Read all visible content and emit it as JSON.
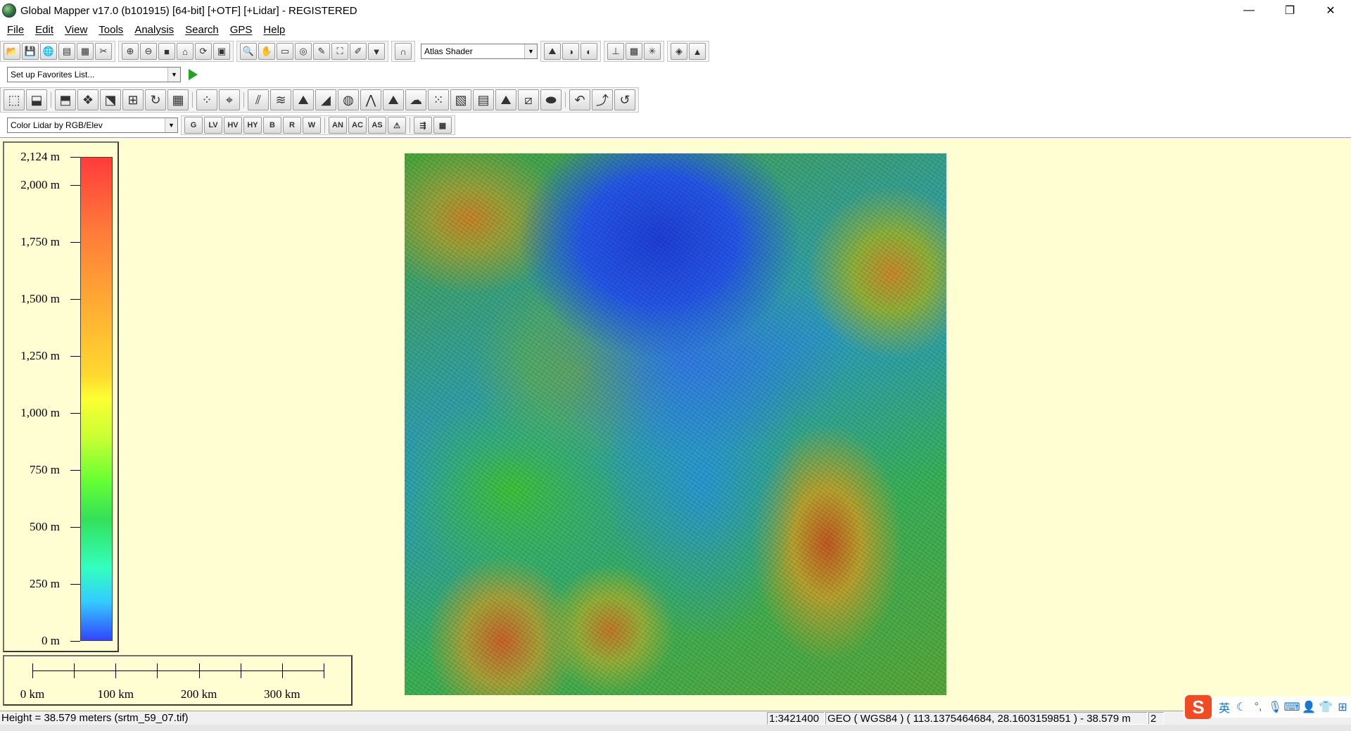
{
  "window": {
    "title": "Global Mapper v17.0 (b101915) [64-bit] [+OTF] [+Lidar] - REGISTERED",
    "minimize_glyph": "—",
    "restore_glyph": "❐",
    "close_glyph": "✕"
  },
  "menu": [
    "File",
    "Edit",
    "View",
    "Tools",
    "Analysis",
    "Search",
    "GPS",
    "Help"
  ],
  "toolbar": {
    "shader_select": "Atlas Shader",
    "favorites_select": "Set up Favorites List...",
    "lidar_color_select": "Color Lidar by RGB/Elev",
    "lidar_buttons": [
      "G",
      "LV",
      "HV",
      "HY",
      "B",
      "R",
      "W",
      "AN",
      "AC",
      "AS"
    ]
  },
  "legend": {
    "labels": [
      "2,124 m",
      "2,000 m",
      "1,750 m",
      "1,500 m",
      "1,250 m",
      "1,000 m",
      "750 m",
      "500 m",
      "250 m",
      "0 m"
    ],
    "values_m": [
      2124,
      2000,
      1750,
      1500,
      1250,
      1000,
      750,
      500,
      250,
      0
    ]
  },
  "scale_bar": {
    "labels": [
      "0 km",
      "100 km",
      "200 km",
      "300 km"
    ]
  },
  "status": {
    "height_info": "Height = 38.579 meters (srtm_59_07.tif)",
    "scale": "1:3421400",
    "position": "GEO ( WGS84 ) ( 113.1375464684, 28.1603159851 ) - 38.579 m",
    "extra": "2"
  },
  "ime": {
    "logo": "S",
    "lang": "英"
  },
  "colors": {
    "map_background": "#fffed2",
    "legend_high": "#ff3b3b",
    "legend_low": "#3344ff",
    "accent_play": "#22a322"
  }
}
